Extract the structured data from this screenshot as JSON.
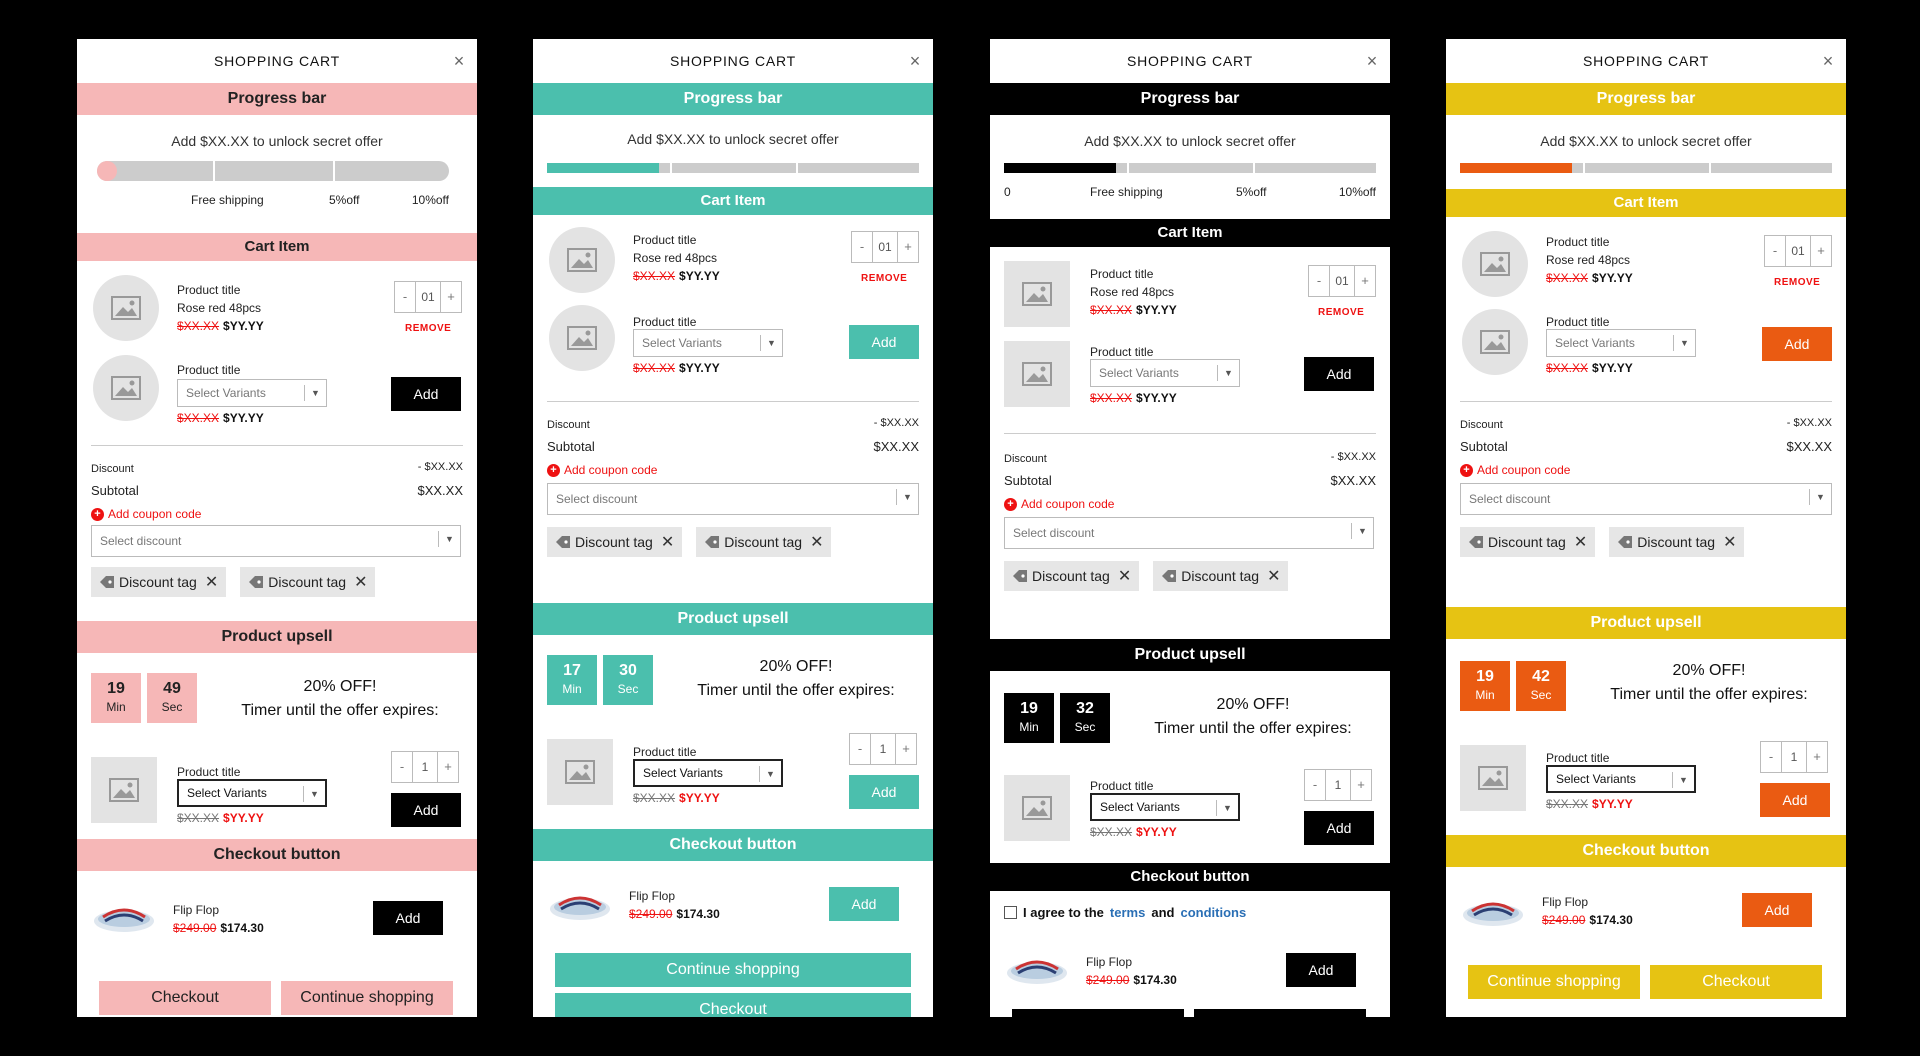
{
  "cart": {
    "title": "SHOPPING CART",
    "close": "×",
    "sections": {
      "progress": "Progress bar",
      "cart_item": "Cart Item",
      "upsell": "Product upsell",
      "checkout": "Checkout button"
    },
    "offer_text": "Add $XX.XX to unlock secret offer",
    "milestones": {
      "start": "0",
      "free_shipping": "Free shipping",
      "five_off": "5%off",
      "ten_off": "10%off"
    },
    "item1": {
      "title": "Product title",
      "variant": "Rose red 48pcs",
      "old_price": "$XX.XX",
      "new_price": "$YY.YY",
      "qty": "01",
      "minus": "-",
      "plus": "+",
      "remove": "REMOVE"
    },
    "item2": {
      "title": "Product title",
      "select_placeholder": "Select Variants",
      "old_price": "$XX.XX",
      "new_price": "$YY.YY",
      "add": "Add"
    },
    "summary": {
      "discount_label": "Discount",
      "discount_value": "- $XX.XX",
      "subtotal_label": "Subtotal",
      "subtotal_value": "$XX.XX",
      "coupon": "Add coupon code",
      "select_discount": "Select discount",
      "tag": "Discount tag"
    },
    "upsell": {
      "offer_title": "20% OFF!",
      "offer_sub": "Timer until the offer expires:",
      "min_label": "Min",
      "sec_label": "Sec",
      "title": "Product title",
      "select": "Select Variants",
      "old_price": "$XX.XX",
      "new_price": "$YY.YY",
      "qty": "1",
      "add": "Add"
    },
    "checkout": {
      "product": "Flip Flop",
      "old_price": "$249.00",
      "new_price": "$174.30",
      "add": "Add",
      "checkout": "Checkout",
      "continue": "Continue shopping",
      "agree_prefix": "I agree to the",
      "terms": "terms",
      "and": "and",
      "conditions": "conditions"
    }
  },
  "panels": [
    {
      "theme": "pink",
      "accent": "#f6b7b7",
      "progress_fraction": 0.0,
      "timer_min": "19",
      "timer_sec": "49"
    },
    {
      "theme": "teal",
      "accent": "#4bbfad",
      "progress_fraction": 0.3,
      "timer_min": "17",
      "timer_sec": "30"
    },
    {
      "theme": "black",
      "accent": "#000000",
      "progress_fraction": 0.3,
      "timer_min": "19",
      "timer_sec": "32"
    },
    {
      "theme": "yellow",
      "accent": "#e6c313",
      "fill_color": "#ea5b12",
      "progress_fraction": 0.3,
      "timer_min": "19",
      "timer_sec": "42"
    }
  ],
  "icons": {
    "image_placeholder": "image-placeholder-icon",
    "tag": "tag-icon",
    "close": "close-icon",
    "shoe": "flip-flop-image"
  }
}
